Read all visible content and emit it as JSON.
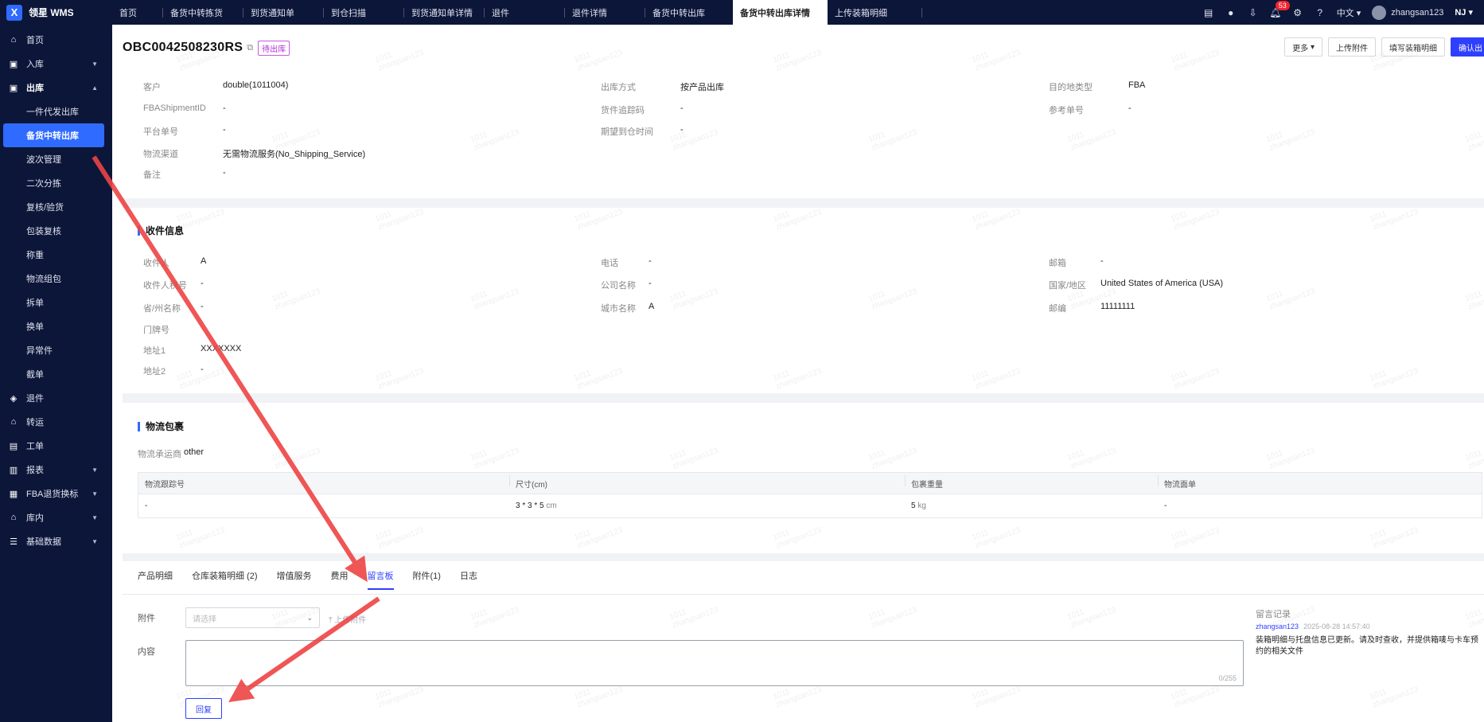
{
  "app": {
    "name": "领星 WMS",
    "logo_glyph": "X"
  },
  "nav": {
    "tabs": [
      "首页",
      "备货中转拣货",
      "到货通知单",
      "到仓扫描",
      "到货通知单详情",
      "退件",
      "退件详情",
      "备货中转出库",
      "备货中转出库详情",
      "上传装箱明细"
    ],
    "active_index": 8
  },
  "topright": {
    "notify_count": "53",
    "language": "中文",
    "username": "zhangsan123",
    "workspace": "NJ"
  },
  "sidebar": {
    "items": [
      {
        "label": "首页",
        "icon": "home-icon"
      },
      {
        "label": "入库",
        "icon": "inbound-icon"
      },
      {
        "label": "出库",
        "icon": "outbound-icon"
      },
      {
        "label": "退件",
        "icon": "return-icon"
      },
      {
        "label": "转运",
        "icon": "transfer-icon"
      },
      {
        "label": "工单",
        "icon": "workorder-icon"
      },
      {
        "label": "报表",
        "icon": "report-icon"
      },
      {
        "label": "FBA退货换标",
        "icon": "fba-icon"
      },
      {
        "label": "库内",
        "icon": "warehouse-icon"
      },
      {
        "label": "基础数据",
        "icon": "data-icon"
      }
    ],
    "sub_items": [
      "一件代发出库",
      "备货中转出库",
      "波次管理",
      "二次分拣",
      "复核/验货",
      "包装复核",
      "称重",
      "物流组包",
      "拆单",
      "换单",
      "异常件",
      "截单"
    ],
    "active_sub": "备货中转出库"
  },
  "header": {
    "order_no": "OBC0042508230RS",
    "status": "待出库",
    "actions": [
      "更多",
      "上传附件",
      "填写装箱明细",
      "确认出"
    ]
  },
  "basic": {
    "customer_label": "客户",
    "customer": "double(1011004)",
    "fba_id_label": "FBAShipmentID",
    "fba_id": "-",
    "platform_no_label": "平台单号",
    "platform_no": "-",
    "channel_label": "物流渠道",
    "channel": "无需物流服务(No_Shipping_Service)",
    "remark_label": "备注",
    "remark": "-",
    "out_method_label": "出库方式",
    "out_method": "按产品出库",
    "tracking_label": "货件追踪码",
    "tracking": "-",
    "expected_label": "期望到仓时间",
    "expected": "-",
    "dest_type_label": "目的地类型",
    "dest_type": "FBA",
    "ref_no_label": "参考单号",
    "ref_no": "-"
  },
  "recipient": {
    "title": "收件信息",
    "name_label": "收件人",
    "name": "A",
    "tax_label": "收件人税号",
    "tax": "-",
    "state_label": "省/州名称",
    "state": "-",
    "door_label": "门牌号",
    "door": "",
    "addr1_label": "地址1",
    "addr1": "XXXXXXX",
    "addr2_label": "地址2",
    "addr2": "-",
    "phone_label": "电话",
    "phone": "-",
    "company_label": "公司名称",
    "company": "-",
    "city_label": "城市名称",
    "city": "A",
    "email_label": "邮箱",
    "email": "-",
    "country_label": "国家/地区",
    "country": "United States of America (USA)",
    "zip_label": "邮编",
    "zip": "11111111"
  },
  "logistics": {
    "title": "物流包裹",
    "carrier_label": "物流承运商",
    "carrier": "other",
    "columns": [
      "物流跟踪号",
      "尺寸(cm)",
      "包裹重量",
      "物流面单"
    ],
    "rows": [
      {
        "tracking": "-",
        "size": "3 * 3 * 5",
        "size_unit": "cm",
        "weight": "5",
        "weight_unit": "kg",
        "label": "-"
      }
    ]
  },
  "detail_tabs": {
    "tabs": [
      "产品明细",
      "仓库装箱明细 (2)",
      "增值服务",
      "费用",
      "留言板",
      "附件(1)",
      "日志"
    ],
    "active_index": 4
  },
  "message_form": {
    "attach_label": "附件",
    "attach_placeholder": "请选择",
    "upload_label": "上传附件",
    "content_label": "内容",
    "counter": "0/255",
    "reply_label": "回复"
  },
  "message_log": {
    "title": "留言记录",
    "user": "zhangsan123",
    "time": "2025-08-28 14:57:40",
    "text": "装箱明细与托盘信息已更新。请及时查收，并提供箱唛与卡车预约的相关文件"
  },
  "watermark": {
    "line1": "1011",
    "line2": "zhangsan123"
  },
  "colors": {
    "sidebar_bg": "#0c1639",
    "accent": "#2f3fff",
    "arrow": "#ee4444",
    "status_tag": "#b330d6"
  }
}
